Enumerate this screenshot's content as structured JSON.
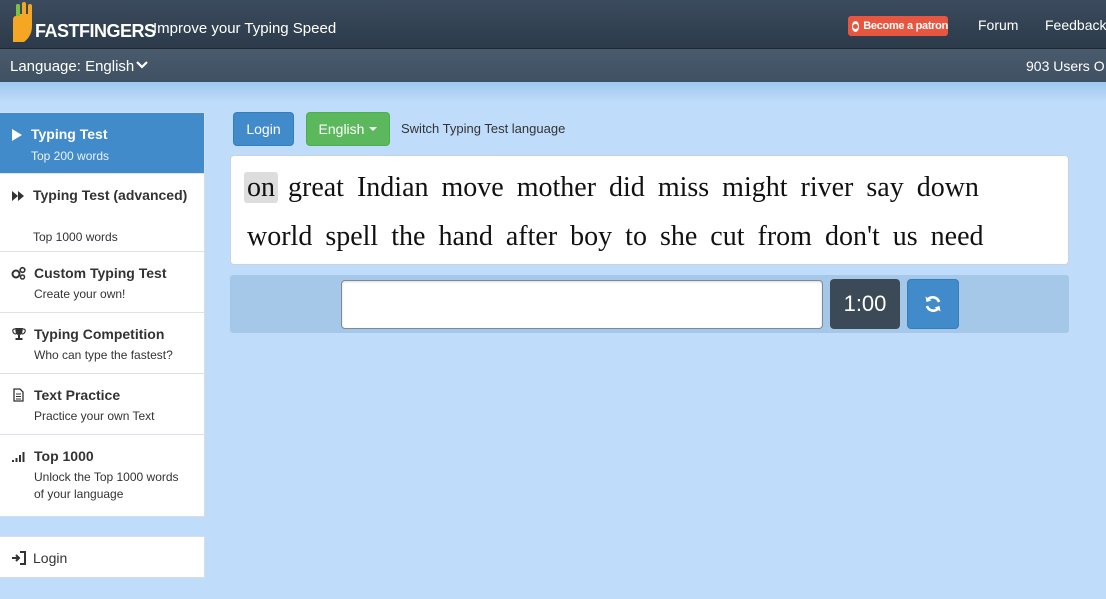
{
  "header": {
    "logo_text": "FASTFINGERS",
    "tagline": "Improve your Typing Speed",
    "patron_label": "Become a patron",
    "nav": [
      "Forum",
      "Feedback"
    ]
  },
  "langbar": {
    "language_label": "Language: English",
    "users_online": "903 Users O"
  },
  "sidebar": {
    "items": [
      {
        "title": "Typing Test",
        "subtitle": "Top 200 words",
        "icon": "play-icon",
        "active": true
      },
      {
        "title": "Typing Test (advanced)",
        "subtitle": "Top 1000 words",
        "icon": "fast-forward-icon"
      },
      {
        "title": "Custom Typing Test",
        "subtitle": "Create your own!",
        "icon": "gears-icon"
      },
      {
        "title": "Typing Competition",
        "subtitle": "Who can type the fastest?",
        "icon": "trophy-icon"
      },
      {
        "title": "Text Practice",
        "subtitle": "Practice your own Text",
        "icon": "document-icon"
      },
      {
        "title": "Top 1000",
        "subtitle": "Unlock the Top 1000 words of your language",
        "icon": "signal-bars-icon"
      }
    ],
    "login_label": "Login"
  },
  "main": {
    "login_button": "Login",
    "language_button": "English",
    "switch_label": "Switch Typing Test language",
    "words_line1": [
      "on",
      "great",
      "Indian",
      "move",
      "mother",
      "did",
      "miss",
      "might",
      "river",
      "say",
      "down"
    ],
    "words_line2": [
      "world",
      "spell",
      "the",
      "hand",
      "after",
      "boy",
      "to",
      "she",
      "cut",
      "from",
      "don't",
      "us",
      "need"
    ],
    "input_value": "",
    "timer": "1:00"
  },
  "colors": {
    "active_blue": "#428bca",
    "green": "#5cb85c",
    "patron": "#e8563f",
    "page_bg": "#bfdcfa"
  }
}
